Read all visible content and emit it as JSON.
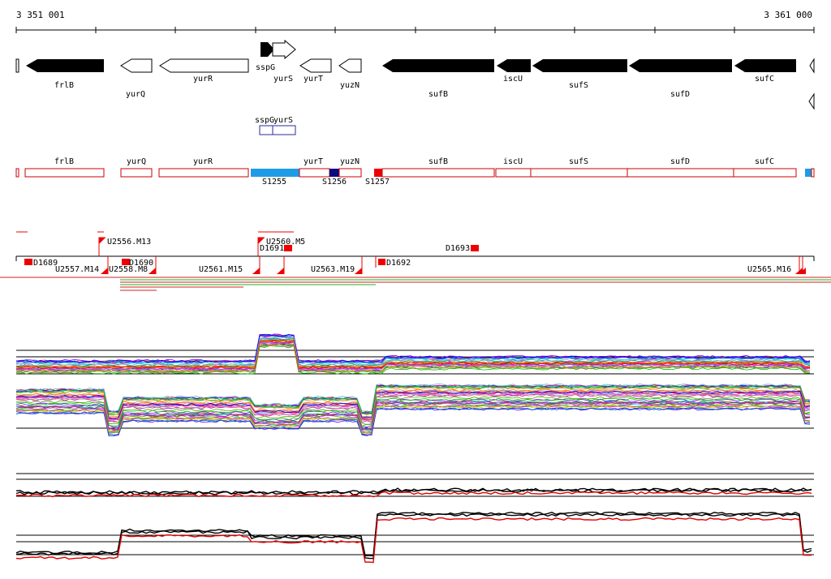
{
  "coords": {
    "start": "3 351 001",
    "end": "3 361 000"
  },
  "genes": [
    {
      "label": "frlB"
    },
    {
      "label": "yurQ"
    },
    {
      "label": "yurR"
    },
    {
      "label": "sspG"
    },
    {
      "label": "yurS"
    },
    {
      "label": "yurT"
    },
    {
      "label": "yuzN"
    },
    {
      "label": "sufB"
    },
    {
      "label": "iscU"
    },
    {
      "label": "sufS"
    },
    {
      "label": "sufD"
    },
    {
      "label": "sufC"
    }
  ],
  "small_genes": [
    {
      "label": "sspG"
    },
    {
      "label": "yurS"
    }
  ],
  "segments": [
    {
      "label": "frlB"
    },
    {
      "label": "yurQ"
    },
    {
      "label": "yurR"
    },
    {
      "label": "yurT"
    },
    {
      "label": "yuzN"
    },
    {
      "label": "sufB"
    },
    {
      "label": "iscU"
    },
    {
      "label": "sufS"
    },
    {
      "label": "sufD"
    },
    {
      "label": "sufC"
    }
  ],
  "segment_ids": [
    "S1255",
    "S1256",
    "S1257"
  ],
  "features": [
    "U2556.M13",
    "U2560.M5",
    "D1691",
    "D1693",
    "D1689",
    "U2557.M14",
    "U2558.M8",
    "D1690",
    "U2561.M15",
    "U2563.M19",
    "D1692",
    "U2565.M16"
  ],
  "colors": {
    "gene_fill": "#000000",
    "segment_outline": "#cc0000",
    "segment_highlight": "#1e9be6",
    "segment_dark": "#0c0c80",
    "feature_red": "#ee0000"
  }
}
